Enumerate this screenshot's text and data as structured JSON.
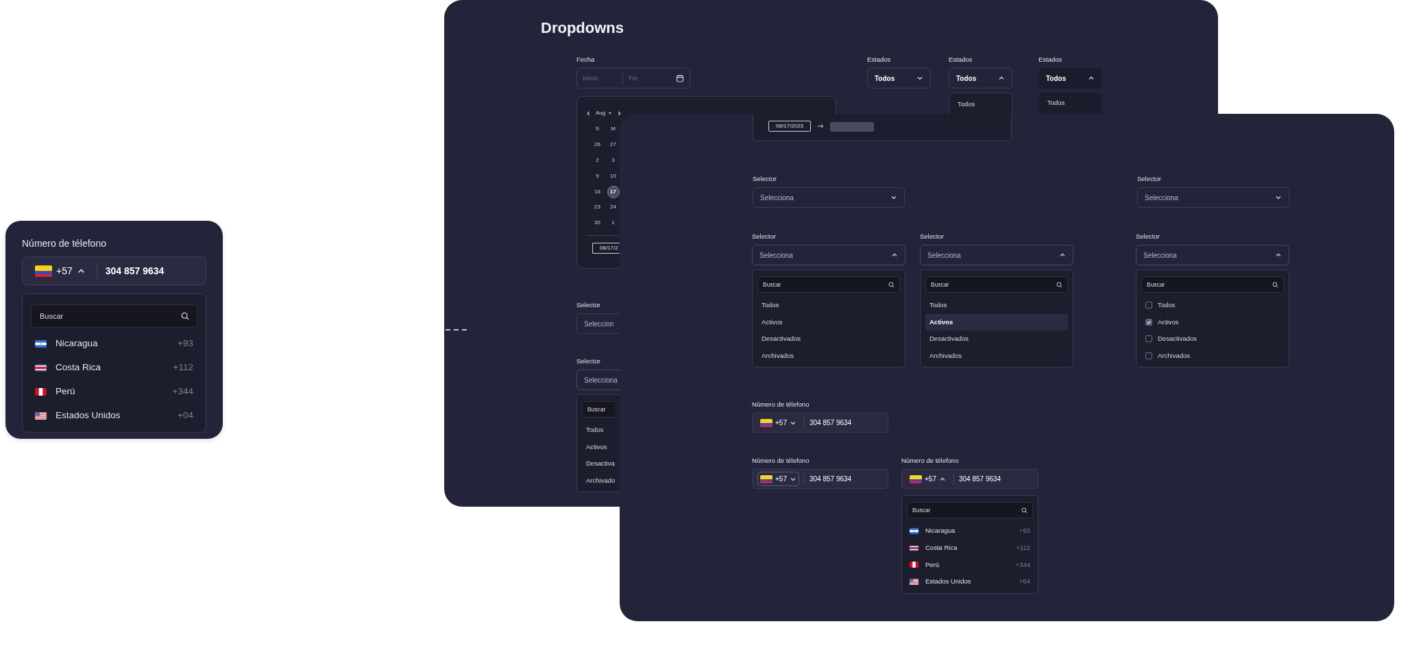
{
  "phone_card": {
    "label": "Número de télefono",
    "field": {
      "code": "+57",
      "expanded": true,
      "chip_highlighted": false,
      "number": "304 857 9634"
    },
    "menu": {
      "search_placeholder": "Buscar",
      "countries": [
        {
          "kind": "nicaragua",
          "name": "Nicaragua",
          "code": "+93"
        },
        {
          "kind": "costa_rica",
          "name": "Costa Rica",
          "code": "+112"
        },
        {
          "kind": "peru",
          "name": "Perú",
          "code": "+344"
        },
        {
          "kind": "usa",
          "name": "Estados Unidos",
          "code": "+04"
        }
      ]
    }
  },
  "back_panel": {
    "title": "Dropdowns",
    "date_range": {
      "label": "Fecha",
      "start_placeholder": "Inicio",
      "end_placeholder": "Fin"
    },
    "calendar": {
      "month": "Aug",
      "weekdays": [
        "S",
        "M"
      ],
      "weeks": [
        [
          {
            "day": "26",
            "selected": false
          },
          {
            "day": "27",
            "selected": false
          }
        ],
        [
          {
            "day": "2",
            "selected": false
          },
          {
            "day": "3",
            "selected": false
          }
        ],
        [
          {
            "day": "9",
            "selected": false
          },
          {
            "day": "10",
            "selected": false
          }
        ],
        [
          {
            "day": "16",
            "selected": false
          },
          {
            "day": "17",
            "selected": true
          }
        ],
        [
          {
            "day": "23",
            "selected": false
          },
          {
            "day": "24",
            "selected": false
          }
        ],
        [
          {
            "day": "30",
            "selected": false
          },
          {
            "day": "1",
            "selected": false
          }
        ]
      ],
      "start_date": "08/17/2"
    },
    "estados": [
      {
        "label": "Estados",
        "value": "Todos",
        "kind": "outlined",
        "expanded": false
      },
      {
        "label": "Estados",
        "value": "Todos",
        "kind": "outlined",
        "expanded": true,
        "menu": {
          "kind": "list",
          "options": [
            {
              "label": "Todos",
              "selected": false
            }
          ]
        }
      },
      {
        "label": "Estados",
        "value": "Todos",
        "kind": "filled",
        "expanded": true,
        "menu": {
          "kind": "list",
          "options": [
            {
              "label": "Todos",
              "selected": false
            }
          ]
        }
      }
    ],
    "selectors": [
      {
        "label": "Selector",
        "prompt": "Seleccion",
        "expanded": false
      },
      {
        "label": "Selector",
        "prompt": "Selecciona",
        "expanded": true,
        "menu": {
          "kind": "list",
          "search_placeholder": "Buscar",
          "options": [
            {
              "label": "Todos",
              "selected": false
            },
            {
              "label": "Activos",
              "selected": false
            },
            {
              "label": "Desactiva",
              "selected": false
            },
            {
              "label": "Archivado",
              "selected": false
            }
          ]
        }
      }
    ]
  },
  "front_panel": {
    "date_card": {
      "start_date": "08/17/2023"
    },
    "selectors": [
      {
        "label": "Selector",
        "prompt": "Selecciona",
        "expanded": false
      },
      {
        "label": "Selector",
        "prompt": "Selecciona",
        "expanded": false
      },
      {
        "label": "Selector",
        "prompt": "Selecciona",
        "expanded": true,
        "menu": {
          "kind": "list",
          "search_placeholder": "Buscar",
          "options": [
            {
              "label": "Todos",
              "selected": false
            },
            {
              "label": "Activos",
              "selected": false
            },
            {
              "label": "Desactivados",
              "selected": false
            },
            {
              "label": "Archivados",
              "selected": false
            }
          ]
        }
      },
      {
        "label": "Selector",
        "prompt": "Selecciona",
        "expanded": true,
        "menu": {
          "kind": "list",
          "search_placeholder": "Buscar",
          "options": [
            {
              "label": "Todos",
              "selected": false
            },
            {
              "label": "Activos",
              "selected": true
            },
            {
              "label": "Desactivados",
              "selected": false
            },
            {
              "label": "Archivados",
              "selected": false
            }
          ]
        }
      },
      {
        "label": "Selector",
        "prompt": "Selecciona",
        "expanded": true,
        "menu": {
          "kind": "checklist",
          "search_placeholder": "Buscar",
          "options": [
            {
              "label": "Todos",
              "checked": false
            },
            {
              "label": "Activos",
              "checked": true
            },
            {
              "label": "Desactivados",
              "checked": false
            },
            {
              "label": "Archivados",
              "checked": false
            }
          ]
        }
      }
    ],
    "phones": [
      {
        "label": "Número de télefono",
        "field": {
          "code": "+57",
          "expanded": false,
          "chip_highlighted": false,
          "number": "304 857 9634"
        }
      },
      {
        "label": "Número de télefono",
        "field": {
          "code": "+57",
          "expanded": false,
          "chip_highlighted": true,
          "number": "304 857 9634"
        }
      },
      {
        "label": "Número de télefono",
        "field": {
          "code": "+57",
          "expanded": true,
          "chip_highlighted": false,
          "number": "304 857 9634"
        },
        "menu": {
          "search_placeholder": "Buscar",
          "countries": [
            {
              "kind": "nicaragua",
              "name": "Nicaragua",
              "code": "+93"
            },
            {
              "kind": "costa_rica",
              "name": "Costa Rica",
              "code": "+112"
            },
            {
              "kind": "peru",
              "name": "Perú",
              "code": "+344"
            },
            {
              "kind": "usa",
              "name": "Estados Unidos",
              "code": "+04"
            }
          ]
        }
      }
    ]
  }
}
